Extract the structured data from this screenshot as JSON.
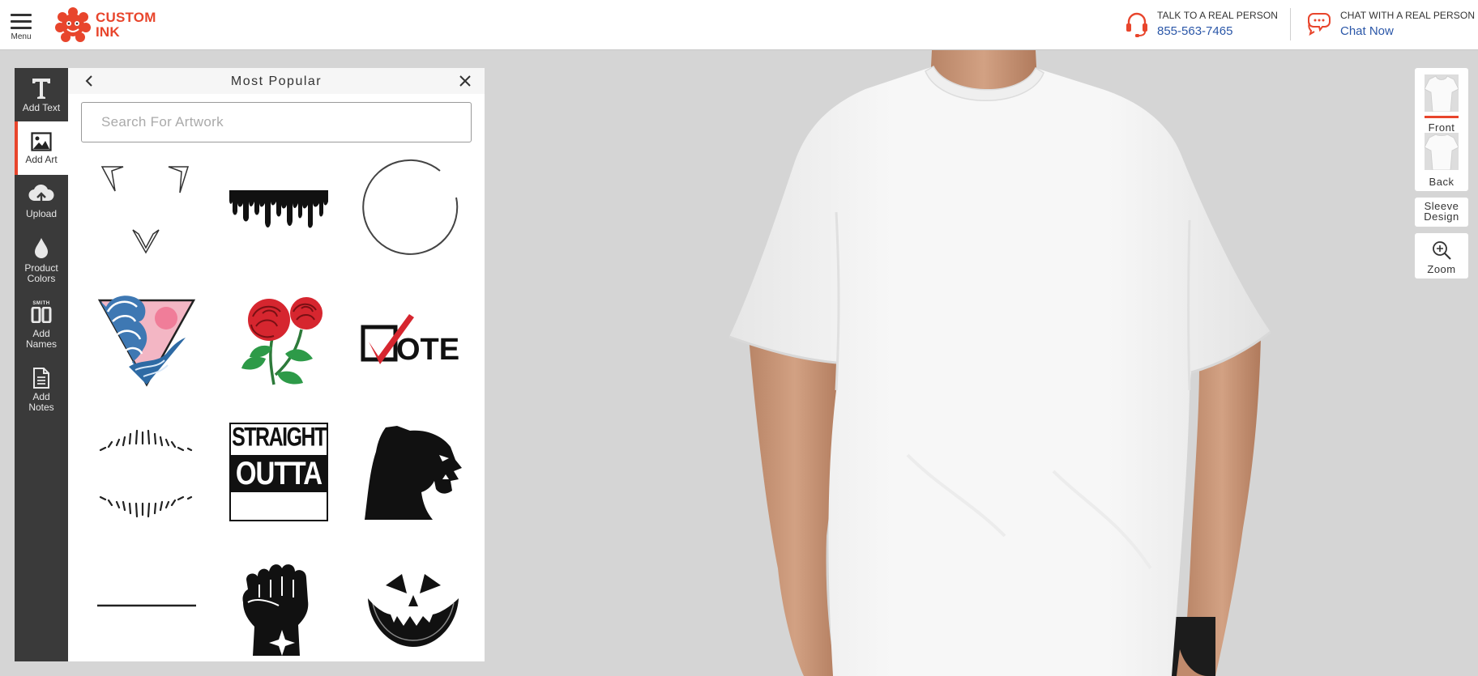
{
  "header": {
    "menu_label": "Menu",
    "logo_line1": "CUSTOM",
    "logo_line2": "INK",
    "phone_label": "TALK TO A REAL PERSON",
    "phone_number": "855-563-7465",
    "chat_label": "CHAT WITH A REAL PERSON",
    "chat_link": "Chat Now"
  },
  "toolbar": {
    "items": [
      {
        "label": "Add Text",
        "icon": "text-t-icon"
      },
      {
        "label": "Add Art",
        "icon": "image-icon"
      },
      {
        "label": "Upload",
        "icon": "cloud-upload-icon"
      },
      {
        "label": "Product Colors",
        "icon": "color-drop-icon"
      },
      {
        "label": "Add Names",
        "icon": "names-numbers-icon",
        "icon_caption": "SMITH"
      },
      {
        "label": "Add Notes",
        "icon": "document-icon"
      }
    ]
  },
  "panel": {
    "title": "Most Popular",
    "search_placeholder": "Search For Artwork",
    "art_items": [
      {
        "name": "triangle-corners-frame"
      },
      {
        "name": "paint-drip"
      },
      {
        "name": "open-circle-frame"
      },
      {
        "name": "great-wave-triangle"
      },
      {
        "name": "red-roses"
      },
      {
        "name": "vote-checkbox",
        "text": "OTE"
      },
      {
        "name": "sunburst-lines"
      },
      {
        "name": "straight-outta",
        "text1": "STRAIGHT",
        "text2": "OUTTA"
      },
      {
        "name": "panther-head"
      },
      {
        "name": "horizontal-line"
      },
      {
        "name": "raised-fist"
      },
      {
        "name": "jack-o-lantern-face"
      }
    ]
  },
  "views": {
    "front": "Front",
    "back": "Back",
    "sleeve_line1": "Sleeve",
    "sleeve_line2": "Design",
    "zoom": "Zoom"
  },
  "colors": {
    "brand": "#e8452c",
    "link": "#2b57a8",
    "toolbar_bg": "#3a3a3a",
    "canvas_bg": "#d5d5d5"
  }
}
